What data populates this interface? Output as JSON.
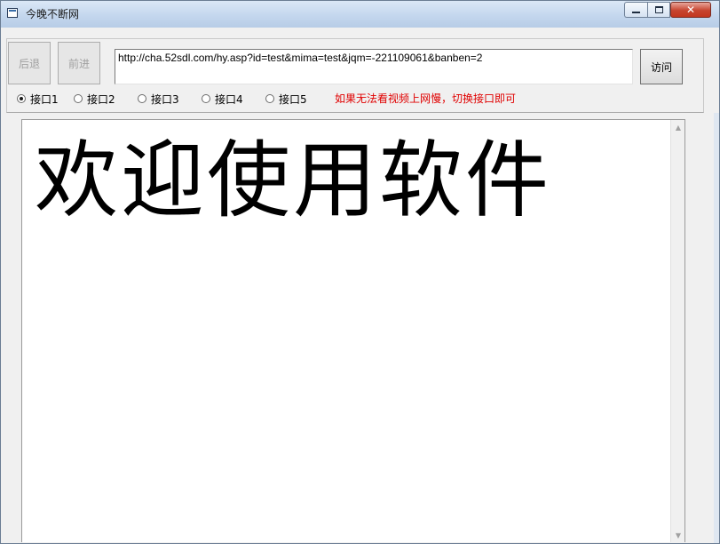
{
  "window": {
    "title": "今晚不断网",
    "minimize": "minimize",
    "maximize": "maximize",
    "close": "close"
  },
  "toolbar": {
    "back_label": "后退",
    "forward_label": "前进",
    "url_value": "http://cha.52sdl.com/hy.asp?id=test&mima=test&jqm=-221109061&banben=2",
    "visit_label": "访问"
  },
  "interfaces": {
    "selected": "接口1",
    "options": [
      "接口1",
      "接口2",
      "接口3",
      "接口4",
      "接口5"
    ],
    "notice": "如果无法看视频上网慢，切换接口即可",
    "notice_color": "#e00000"
  },
  "browser": {
    "welcome_text": "欢迎使用软件"
  },
  "icons": {
    "app": "app-window-icon",
    "scroll_up": "scroll-up-arrow-icon",
    "scroll_down": "scroll-down-arrow-icon"
  }
}
